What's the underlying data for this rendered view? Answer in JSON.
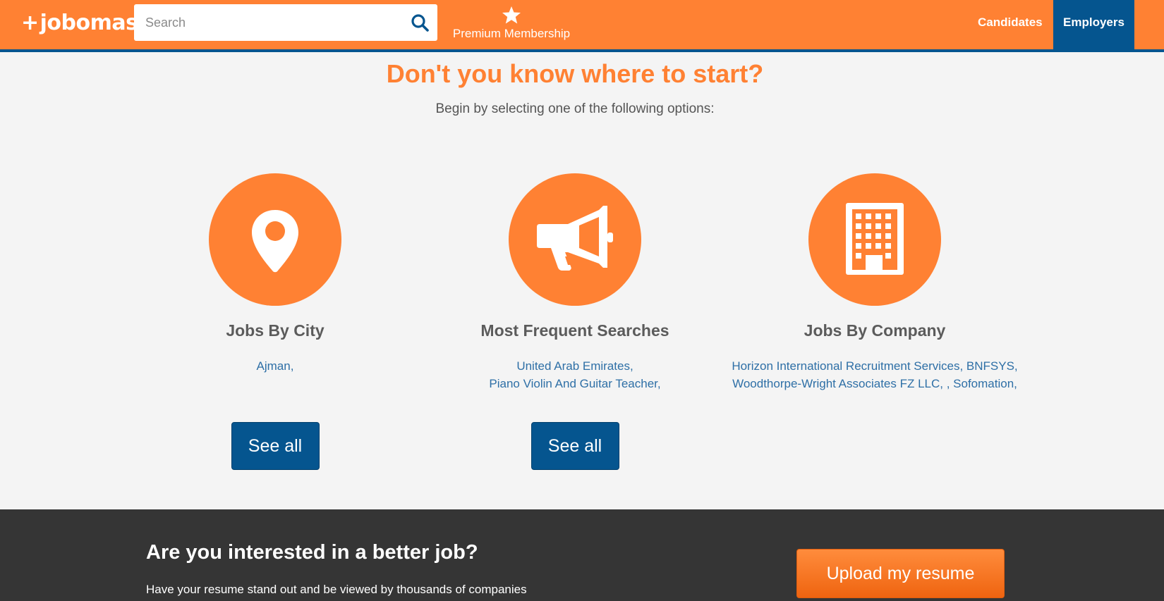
{
  "header": {
    "logo_plus": "+",
    "logo_text": "jobomas",
    "search_placeholder": "Search",
    "premium_label": "Premium Membership",
    "nav_candidates": "Candidates",
    "nav_employers": "Employers"
  },
  "hero": {
    "title": "Don't you know where to start?",
    "subtitle": "Begin by selecting one of the following options:"
  },
  "columns": [
    {
      "icon": "map-pin-icon",
      "title": "Jobs By City",
      "items": [
        "Ajman,"
      ],
      "button": "See all"
    },
    {
      "icon": "megaphone-icon",
      "title": "Most Frequent Searches",
      "items": [
        "United Arab Emirates,",
        "Piano Violin And Guitar Teacher,"
      ],
      "button": "See all"
    },
    {
      "icon": "building-icon",
      "title": "Jobs By Company",
      "items": [
        "Horizon International Recruitment Services, BNFSYS,",
        "Woodthorpe-Wright Associates FZ LLC, , Sofomation,"
      ]
    }
  ],
  "band": {
    "title": "Are you interested in a better job?",
    "subtitle": "Have your resume stand out and be viewed by thousands of companies",
    "upload_button": "Upload my resume"
  },
  "colors": {
    "brand_orange": "#ff8133",
    "brand_blue": "#05558f",
    "dark_band": "#353535"
  }
}
